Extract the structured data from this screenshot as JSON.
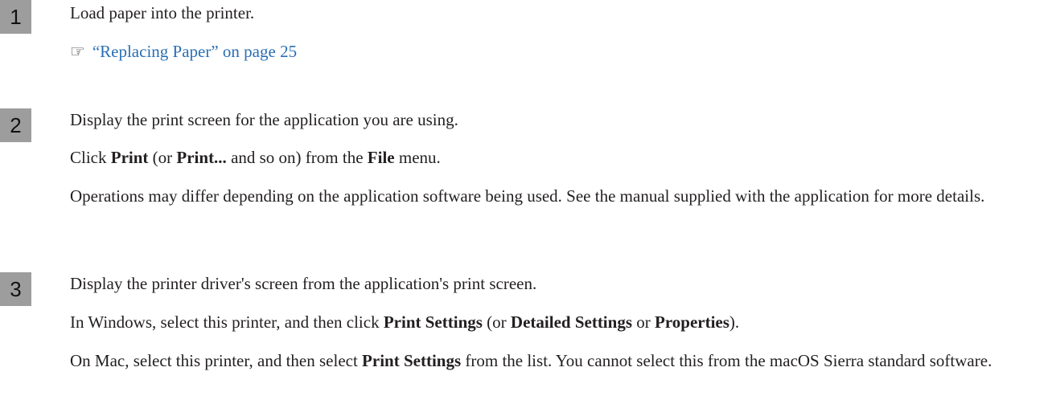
{
  "steps": [
    {
      "number": "1",
      "title": "Load paper into the printer.",
      "ref_icon": "reference-arrow-icon",
      "ref_link": "“Replacing Paper” on page 25"
    },
    {
      "number": "2",
      "title": "Display the print screen for the application you are using.",
      "p1": {
        "t1": "Click ",
        "b1": "Print",
        "t2": " (or ",
        "b2": "Print...",
        "t3": " and so on) from the ",
        "b3": "File",
        "t4": " menu."
      },
      "p2": "Operations may differ depending on the application software being used. See the manual supplied with the application for more details."
    },
    {
      "number": "3",
      "title": "Display the printer driver's screen from the application's print screen.",
      "p1": {
        "t1": "In Windows, select this printer, and then click ",
        "b1": "Print Settings",
        "t2": " (or ",
        "b2": "Detailed Settings",
        "t3": " or ",
        "b3": "Properties",
        "t4": ")."
      },
      "p2": {
        "t1": "On Mac, select this printer, and then select ",
        "b1": "Print Settings",
        "t2": " from the list. You cannot select this from the macOS Sierra standard software."
      }
    }
  ],
  "colors": {
    "step_badge": "#9d9d9d",
    "link": "#2a6fb4",
    "text": "#231f20"
  }
}
